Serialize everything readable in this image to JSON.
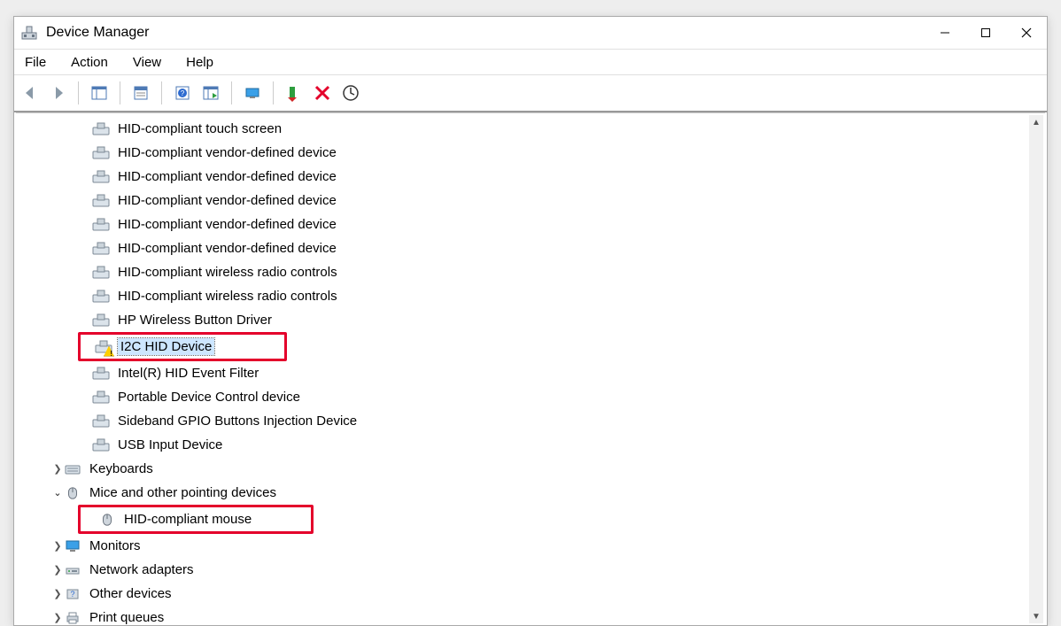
{
  "window": {
    "title": "Device Manager"
  },
  "menu": {
    "file": "File",
    "action": "Action",
    "view": "View",
    "help": "Help"
  },
  "toolbar_icons": {
    "back": "back-arrow",
    "fwd": "forward-arrow",
    "showhide": "show-hide-console-tree",
    "props": "properties",
    "help": "help",
    "showall": "show-hidden-devices",
    "scan": "scan-for-hardware-changes",
    "add": "add-legacy",
    "remove": "uninstall",
    "update": "update-driver"
  },
  "tree": {
    "hid": [
      "HID-compliant touch screen",
      "HID-compliant vendor-defined device",
      "HID-compliant vendor-defined device",
      "HID-compliant vendor-defined device",
      "HID-compliant vendor-defined device",
      "HID-compliant vendor-defined device",
      "HID-compliant wireless radio controls",
      "HID-compliant wireless radio controls",
      "HP Wireless Button Driver",
      "I2C HID Device",
      "Intel(R) HID Event Filter",
      "Portable Device Control device",
      "Sideband GPIO Buttons Injection Device",
      "USB Input Device"
    ],
    "keyboards": "Keyboards",
    "mice": "Mice and other pointing devices",
    "mice_items": [
      "HID-compliant mouse"
    ],
    "monitors": "Monitors",
    "network": "Network adapters",
    "other": "Other devices",
    "printq": "Print queues"
  },
  "highlight": {
    "selected_index": 9
  }
}
